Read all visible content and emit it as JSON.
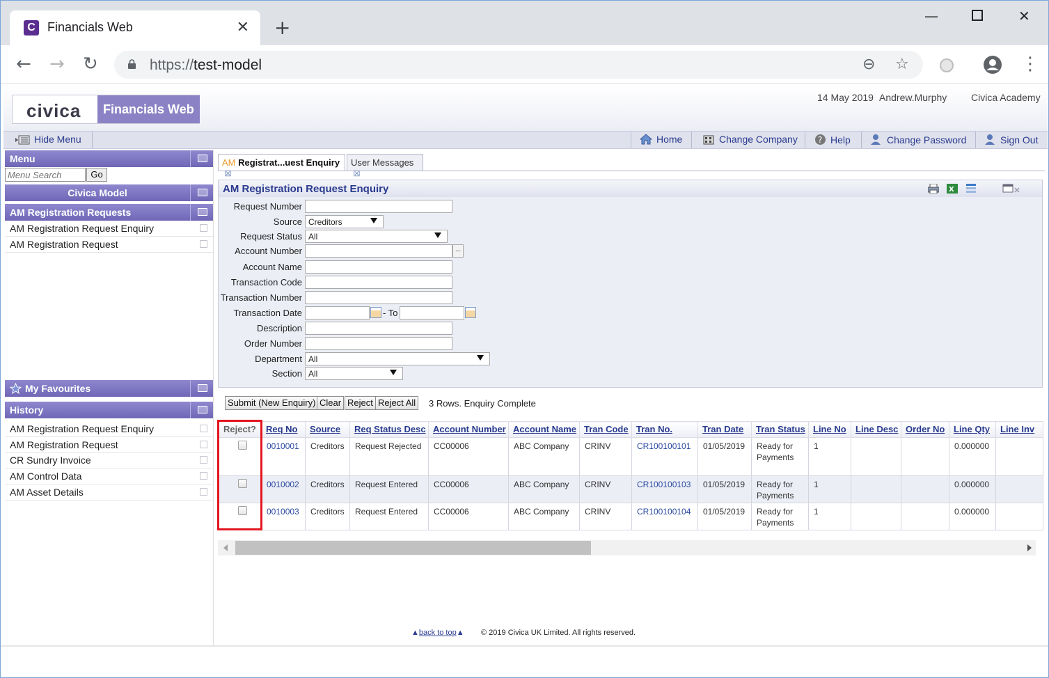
{
  "browser": {
    "tab_title": "Financials Web",
    "tab_icon_letter": "C",
    "url_scheme": "https://",
    "url_host": "test-model"
  },
  "header": {
    "logo_text": "civica",
    "product_name": "Financials Web",
    "date": "14 May 2019",
    "user": "Andrew.Murphy",
    "company": "Civica Academy"
  },
  "toolbar": {
    "hide_menu": "Hide Menu",
    "home": "Home",
    "change_company": "Change Company",
    "help": "Help",
    "change_password": "Change Password",
    "sign_out": "Sign Out"
  },
  "menu": {
    "title": "Menu",
    "search_placeholder": "Menu Search",
    "go": "Go",
    "model": "Civica Model",
    "section": "AM Registration Requests",
    "items": [
      "AM Registration Request Enquiry",
      "AM Registration Request"
    ],
    "favourites_title": "My Favourites",
    "history_title": "History",
    "history_items": [
      "AM Registration Request Enquiry",
      "AM Registration Request",
      "CR Sundry Invoice",
      "AM Control Data",
      "AM Asset Details"
    ]
  },
  "tabs": {
    "active_prefix": "AM",
    "active_label": "Registrat...uest Enquiry",
    "second_label": "User Messages",
    "close_glyph": "⊠"
  },
  "form": {
    "title": "AM Registration Request Enquiry",
    "labels": {
      "request_number": "Request Number",
      "source": "Source",
      "request_status": "Request Status",
      "account_number": "Account Number",
      "account_name": "Account Name",
      "transaction_code": "Transaction Code",
      "transaction_number": "Transaction Number",
      "transaction_date": "Transaction Date",
      "description": "Description",
      "order_number": "Order Number",
      "department": "Department",
      "section": "Section"
    },
    "values": {
      "source": "Creditors",
      "request_status": "All",
      "department": "All",
      "section": "All"
    },
    "date_to": "- To",
    "lookup": "..."
  },
  "actions": {
    "submit": "Submit (New Enquiry)",
    "clear": "Clear",
    "reject": "Reject",
    "reject_all": "Reject All",
    "status": "3 Rows. Enquiry Complete"
  },
  "grid": {
    "columns": [
      "Reject?",
      "Req No",
      "Source",
      "Req Status Desc",
      "Account Number",
      "Account Name",
      "Tran Code",
      "Tran No.",
      "Tran Date",
      "Tran Status",
      "Line No",
      "Line Desc",
      "Order No",
      "Line Qty",
      "Line Inv"
    ],
    "rows": [
      {
        "req_no": "0010001",
        "source": "Creditors",
        "status_desc": "Request Rejected",
        "account_number": "CC00006",
        "account_name": "ABC Company",
        "tran_code": "CRINV",
        "tran_no": "CR100100101",
        "tran_date": "01/05/2019",
        "tran_status": "Ready for Payments",
        "line_no": "1",
        "line_desc": "",
        "order_no": "",
        "line_qty": "0.000000",
        "line_inv": ""
      },
      {
        "req_no": "0010002",
        "source": "Creditors",
        "status_desc": "Request Entered",
        "account_number": "CC00006",
        "account_name": "ABC Company",
        "tran_code": "CRINV",
        "tran_no": "CR100100103",
        "tran_date": "01/05/2019",
        "tran_status": "Ready for Payments",
        "line_no": "1",
        "line_desc": "",
        "order_no": "",
        "line_qty": "0.000000",
        "line_inv": ""
      },
      {
        "req_no": "0010003",
        "source": "Creditors",
        "status_desc": "Request Entered",
        "account_number": "CC00006",
        "account_name": "ABC Company",
        "tran_code": "CRINV",
        "tran_no": "CR100100104",
        "tran_date": "01/05/2019",
        "tran_status": "Ready for Payments",
        "line_no": "1",
        "line_desc": "",
        "order_no": "",
        "line_qty": "0.000000",
        "line_inv": ""
      }
    ]
  },
  "footer": {
    "back_to_top": "back to top",
    "copyright": "© 2019 Civica UK Limited. All rights reserved."
  },
  "colors": {
    "brand_purple": "#8a82c4",
    "link_blue": "#2a3b8f",
    "highlight_red": "#e3161f"
  }
}
